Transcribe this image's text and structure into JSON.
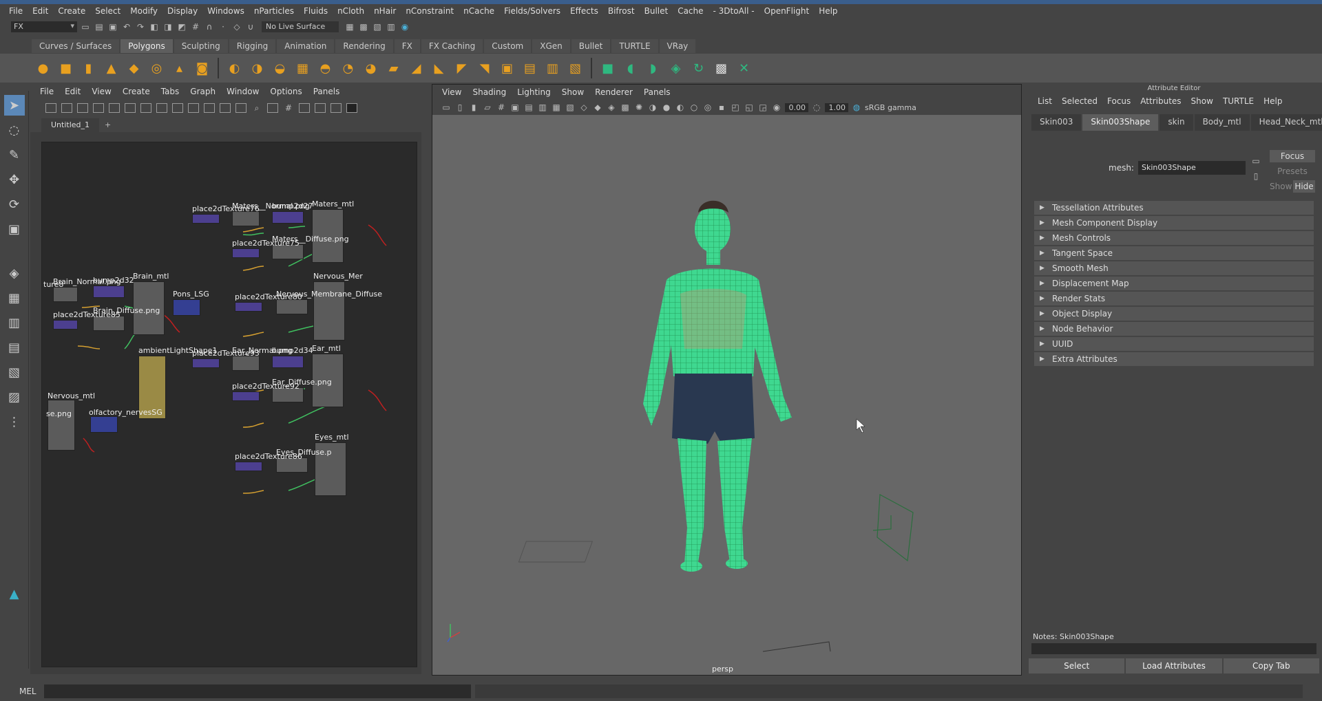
{
  "menu": [
    "File",
    "Edit",
    "Create",
    "Select",
    "Modify",
    "Display",
    "Windows",
    "nParticles",
    "Fluids",
    "nCloth",
    "nHair",
    "nConstraint",
    "nCache",
    "Fields/Solvers",
    "Effects",
    "Bifrost",
    "Bullet",
    "Cache",
    "- 3DtoAll -",
    "OpenFlight",
    "Help"
  ],
  "status": {
    "mode": "FX",
    "live_surface": "No Live Surface"
  },
  "shelf_tabs": [
    "Curves / Surfaces",
    "Polygons",
    "Sculpting",
    "Rigging",
    "Animation",
    "Rendering",
    "FX",
    "FX Caching",
    "Custom",
    "XGen",
    "Bullet",
    "TURTLE",
    "VRay"
  ],
  "hypershade": {
    "menu": [
      "File",
      "Edit",
      "View",
      "Create",
      "Tabs",
      "Graph",
      "Window",
      "Options",
      "Panels"
    ],
    "tab": "Untitled_1",
    "add_tab": "+",
    "labels": [
      "place2dTexture76",
      "Maters__Normal.png",
      "bump2d27",
      "Maters_mtl",
      "place2dTexture75",
      "Maters__Diffuse.png",
      "Brain_Normal.png",
      "bump2d32",
      "Brain_mtl",
      "Pons_LSG",
      "ture8",
      "place2dTexture85",
      "Brain_Diffuse.png",
      "place2dTexture80",
      "Nervous_Membrane_Diffuse",
      "Nervous_Mer",
      "ambientLightShape1",
      "place2dTexture93",
      "Ear_Normal.png",
      "bump2d34",
      "Ear_mtl",
      "place2dTexture92",
      "Ear_Diffuse.png",
      "Nervous_mtl",
      "olfactory_nervesSG",
      "se.png",
      "Eyes_mtl",
      "place2dTexture86",
      "Eyes_Diffuse.p"
    ]
  },
  "viewport": {
    "menu": [
      "View",
      "Shading",
      "Lighting",
      "Show",
      "Renderer",
      "Panels"
    ],
    "field1": "0.00",
    "field2": "1.00",
    "colorspace": "sRGB gamma",
    "camera": "persp"
  },
  "attribute_editor": {
    "title": "Attribute Editor",
    "menu": [
      "List",
      "Selected",
      "Focus",
      "Attributes",
      "Show",
      "TURTLE",
      "Help"
    ],
    "tabs": [
      "Skin003",
      "Skin003Shape",
      "skin",
      "Body_mtl",
      "Head_Neck_mtl"
    ],
    "mesh_label": "mesh:",
    "mesh_value": "Skin003Shape",
    "focus": "Focus",
    "presets": "Presets",
    "show": "Show",
    "hide": "Hide",
    "sections": [
      "Tessellation Attributes",
      "Mesh Component Display",
      "Mesh Controls",
      "Tangent Space",
      "Smooth Mesh",
      "Displacement Map",
      "Render Stats",
      "Object Display",
      "Node Behavior",
      "UUID",
      "Extra Attributes"
    ],
    "notes": "Notes:  Skin003Shape",
    "buttons": [
      "Select",
      "Load Attributes",
      "Copy Tab"
    ]
  },
  "cmdline": {
    "label": "MEL"
  }
}
